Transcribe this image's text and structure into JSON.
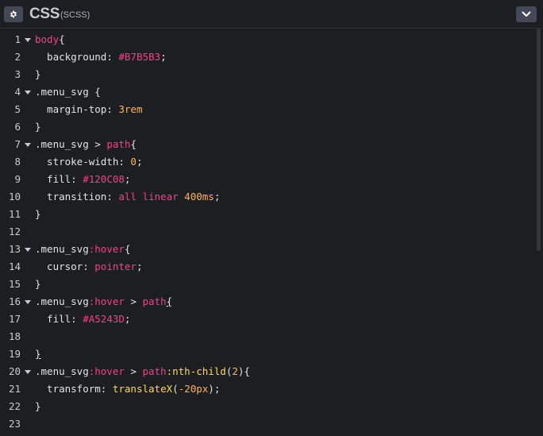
{
  "header": {
    "settings_icon": "gear-icon",
    "title": "CSS",
    "subtitle": "(SCSS)",
    "collapse_icon": "chevron-down-icon"
  },
  "colors": {
    "background": "#1d1e22",
    "button_bg": "#444857",
    "text": "#e3e4e8",
    "tag": "#ff3c8a",
    "number": "#ffb454",
    "function": "#ffdd40"
  },
  "lines": [
    {
      "n": "1",
      "fold": true,
      "tokens": [
        {
          "t": "body",
          "c": "tag"
        },
        {
          "t": "{",
          "c": "plain"
        }
      ]
    },
    {
      "n": "2",
      "fold": false,
      "tokens": [
        {
          "t": "  background",
          "c": "prop"
        },
        {
          "t": ": ",
          "c": "plain"
        },
        {
          "t": "#B7B5B3",
          "c": "color"
        },
        {
          "t": ";",
          "c": "plain"
        }
      ]
    },
    {
      "n": "3",
      "fold": false,
      "tokens": [
        {
          "t": "}",
          "c": "plain"
        }
      ]
    },
    {
      "n": "4",
      "fold": true,
      "tokens": [
        {
          "t": ".menu_svg {",
          "c": "plain"
        }
      ]
    },
    {
      "n": "5",
      "fold": false,
      "tokens": [
        {
          "t": "  margin-top",
          "c": "prop"
        },
        {
          "t": ": ",
          "c": "plain"
        },
        {
          "t": "3rem",
          "c": "num"
        }
      ]
    },
    {
      "n": "6",
      "fold": false,
      "tokens": [
        {
          "t": "}",
          "c": "plain"
        }
      ]
    },
    {
      "n": "7",
      "fold": true,
      "tokens": [
        {
          "t": ".menu_svg > ",
          "c": "plain"
        },
        {
          "t": "path",
          "c": "tag"
        },
        {
          "t": "{",
          "c": "plain"
        }
      ]
    },
    {
      "n": "8",
      "fold": false,
      "tokens": [
        {
          "t": "  stroke-width",
          "c": "prop"
        },
        {
          "t": ": ",
          "c": "plain"
        },
        {
          "t": "0",
          "c": "num"
        },
        {
          "t": ";",
          "c": "plain"
        }
      ]
    },
    {
      "n": "9",
      "fold": false,
      "tokens": [
        {
          "t": "  fill",
          "c": "prop"
        },
        {
          "t": ": ",
          "c": "plain"
        },
        {
          "t": "#120C08",
          "c": "color"
        },
        {
          "t": ";",
          "c": "plain"
        }
      ]
    },
    {
      "n": "10",
      "fold": false,
      "tokens": [
        {
          "t": "  transition",
          "c": "prop"
        },
        {
          "t": ": ",
          "c": "plain"
        },
        {
          "t": "all linear ",
          "c": "kw"
        },
        {
          "t": "400ms",
          "c": "num"
        },
        {
          "t": ";",
          "c": "plain"
        }
      ]
    },
    {
      "n": "11",
      "fold": false,
      "tokens": [
        {
          "t": "}",
          "c": "plain"
        }
      ]
    },
    {
      "n": "12",
      "fold": false,
      "tokens": []
    },
    {
      "n": "13",
      "fold": true,
      "tokens": [
        {
          "t": ".menu_svg",
          "c": "plain"
        },
        {
          "t": ":hover",
          "c": "pseudo"
        },
        {
          "t": "{",
          "c": "plain"
        }
      ]
    },
    {
      "n": "14",
      "fold": false,
      "tokens": [
        {
          "t": "  cursor",
          "c": "prop"
        },
        {
          "t": ": ",
          "c": "plain"
        },
        {
          "t": "pointer",
          "c": "kw"
        },
        {
          "t": ";",
          "c": "plain"
        }
      ]
    },
    {
      "n": "15",
      "fold": false,
      "tokens": [
        {
          "t": "}",
          "c": "plain"
        }
      ]
    },
    {
      "n": "16",
      "fold": true,
      "tokens": [
        {
          "t": ".menu_svg",
          "c": "plain"
        },
        {
          "t": ":hover",
          "c": "pseudo"
        },
        {
          "t": " > ",
          "c": "plain"
        },
        {
          "t": "path",
          "c": "tag"
        },
        {
          "t": "{",
          "c": "under"
        }
      ]
    },
    {
      "n": "17",
      "fold": false,
      "tokens": [
        {
          "t": "  fill",
          "c": "prop"
        },
        {
          "t": ": ",
          "c": "plain"
        },
        {
          "t": "#A5243D",
          "c": "color"
        },
        {
          "t": ";",
          "c": "plain"
        }
      ]
    },
    {
      "n": "18",
      "fold": false,
      "tokens": []
    },
    {
      "n": "19",
      "fold": false,
      "tokens": [
        {
          "t": "}",
          "c": "under"
        }
      ]
    },
    {
      "n": "20",
      "fold": true,
      "tokens": [
        {
          "t": ".menu_svg",
          "c": "plain"
        },
        {
          "t": ":hover",
          "c": "pseudo"
        },
        {
          "t": " > ",
          "c": "plain"
        },
        {
          "t": "path",
          "c": "tag"
        },
        {
          "t": ":nth-child",
          "c": "fn"
        },
        {
          "t": "(",
          "c": "plain"
        },
        {
          "t": "2",
          "c": "num"
        },
        {
          "t": "){",
          "c": "plain"
        }
      ]
    },
    {
      "n": "21",
      "fold": false,
      "tokens": [
        {
          "t": "  transform",
          "c": "prop"
        },
        {
          "t": ": ",
          "c": "plain"
        },
        {
          "t": "translateX",
          "c": "fn"
        },
        {
          "t": "(",
          "c": "plain"
        },
        {
          "t": "-20px",
          "c": "num"
        },
        {
          "t": ");",
          "c": "plain"
        }
      ]
    },
    {
      "n": "22",
      "fold": false,
      "tokens": [
        {
          "t": "}",
          "c": "plain"
        }
      ]
    },
    {
      "n": "23",
      "fold": false,
      "tokens": []
    }
  ]
}
